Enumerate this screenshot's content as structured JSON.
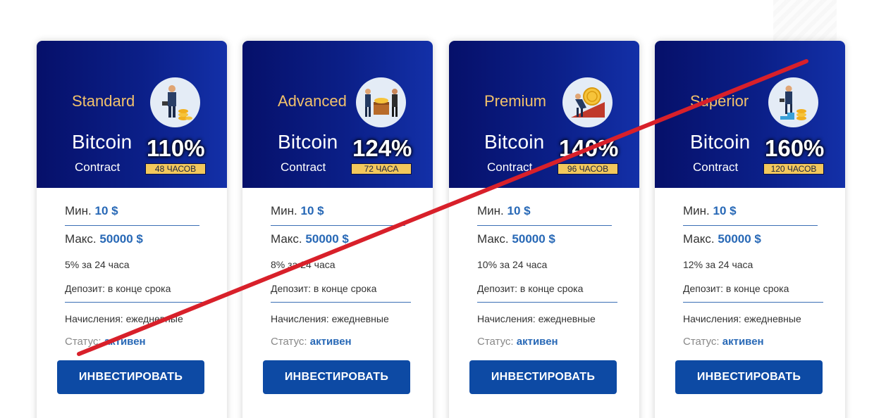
{
  "plans": [
    {
      "name": "Standard",
      "icon": "businessman-coins-icon",
      "title": "Bitcoin",
      "subtitle": "Contract",
      "percent": "110%",
      "duration": "48 ЧАСОВ",
      "min_label": "Мин.",
      "min_value": "10 $",
      "max_label": "Макс.",
      "max_value": "50000 $",
      "rate": "5% за 24 часа",
      "deposit": "Депозит: в конце срока",
      "accrual": "Начисления: ежедневные",
      "status_label": "Статус:",
      "status_value": "активен",
      "button": "ИНВЕСТИРОВАТЬ"
    },
    {
      "name": "Advanced",
      "icon": "partners-chest-icon",
      "title": "Bitcoin",
      "subtitle": "Contract",
      "percent": "124%",
      "duration": "72 ЧАСА",
      "min_label": "Мин.",
      "min_value": "10 $",
      "max_label": "Макс.",
      "max_value": "50000 $",
      "rate": "8% за 24 часа",
      "deposit": "Депозит: в конце срока",
      "accrual": "Начисления: ежедневные",
      "status_label": "Статус:",
      "status_value": "активен",
      "button": "ИНВЕСТИРОВАТЬ"
    },
    {
      "name": "Premium",
      "icon": "man-pushing-coin-icon",
      "title": "Bitcoin",
      "subtitle": "Contract",
      "percent": "140%",
      "duration": "96 ЧАСОВ",
      "min_label": "Мин.",
      "min_value": "10 $",
      "max_label": "Макс.",
      "max_value": "50000 $",
      "rate": "10% за 24 часа",
      "deposit": "Депозит: в конце срока",
      "accrual": "Начисления: ежедневные",
      "status_label": "Статус:",
      "status_value": "активен",
      "button": "ИНВЕСТИРОВАТЬ"
    },
    {
      "name": "Superior",
      "icon": "businessman-stairs-icon",
      "title": "Bitcoin",
      "subtitle": "Contract",
      "percent": "160%",
      "duration": "120 ЧАСОВ",
      "min_label": "Мин.",
      "min_value": "10 $",
      "max_label": "Макс.",
      "max_value": "50000 $",
      "rate": "12% за 24 часа",
      "deposit": "Депозит: в конце срока",
      "accrual": "Начисления: ежедневные",
      "status_label": "Статус:",
      "status_value": "активен",
      "button": "ИНВЕСТИРОВАТЬ"
    }
  ],
  "colors": {
    "header_dark": "#06106a",
    "header_light": "#1330a8",
    "plan_name": "#f2c26b",
    "badge": "#f3c85c",
    "accent_blue": "#2768b6",
    "button": "#0d4aa4",
    "strike_line": "#d8202a"
  }
}
